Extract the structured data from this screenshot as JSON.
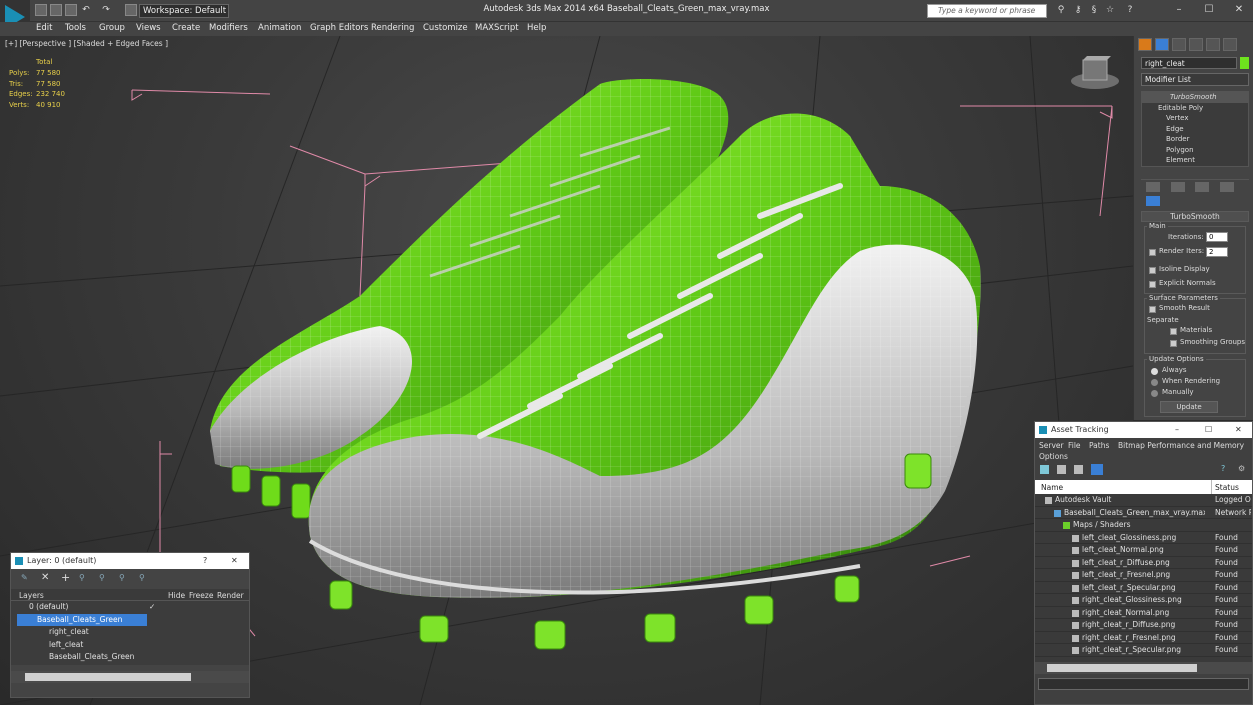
{
  "titlebar": {
    "workspace": "Workspace: Default",
    "title": "Autodesk 3ds Max  2014 x64     Baseball_Cleats_Green_max_vray.max",
    "search_placeholder": "Type a keyword or phrase"
  },
  "menu": [
    "Edit",
    "Tools",
    "Group",
    "Views",
    "Create",
    "Modifiers",
    "Animation",
    "Graph Editors",
    "Rendering",
    "Customize",
    "MAXScript",
    "Help"
  ],
  "viewport": {
    "label": "[+] [Perspective ] [Shaded + Edged Faces ]",
    "stats": {
      "header": "Total",
      "rows": [
        {
          "label": "Polys:",
          "value": "77 580"
        },
        {
          "label": "Tris:",
          "value": "77 580"
        },
        {
          "label": "Edges:",
          "value": "232 740"
        },
        {
          "label": "Verts:",
          "value": "40 910"
        }
      ]
    }
  },
  "command_panel": {
    "object_name": "right_cleat",
    "modifier_list": "Modifier List",
    "stack": [
      "TurboSmooth",
      "Editable Poly",
      "Vertex",
      "Edge",
      "Border",
      "Polygon",
      "Element"
    ],
    "rollout_title": "TurboSmooth",
    "main_label": "Main",
    "iterations_label": "Iterations:",
    "iterations_value": "0",
    "render_iters_label": "Render Iters:",
    "render_iters_value": "2",
    "isoline": "Isoline Display",
    "explicit_normals": "Explicit Normals",
    "surface_params": "Surface Parameters",
    "smooth_result": "Smooth Result",
    "separate": "Separate",
    "materials": "Materials",
    "smoothing_groups": "Smoothing Groups",
    "update_options": "Update Options",
    "always": "Always",
    "when_rendering": "When Rendering",
    "manually": "Manually",
    "update_button": "Update"
  },
  "layers": {
    "title": "Layer: 0 (default)",
    "help": "?",
    "cols": [
      "Layers",
      "Hide",
      "Freeze",
      "Render"
    ],
    "rows": [
      {
        "name": "0 (default)",
        "indent": 0
      },
      {
        "name": "Baseball_Cleats_Green",
        "indent": 0
      },
      {
        "name": "right_cleat",
        "indent": 1
      },
      {
        "name": "left_cleat",
        "indent": 1
      },
      {
        "name": "Baseball_Cleats_Green",
        "indent": 1
      }
    ]
  },
  "asset_tracking": {
    "title": "Asset Tracking",
    "menu": [
      "Server",
      "File",
      "Paths",
      "Bitmap Performance and Memory",
      "Options"
    ],
    "cols": [
      "Name",
      "Status"
    ],
    "rows": [
      {
        "name": "Autodesk Vault",
        "status": "Logged Ou",
        "indent": 0
      },
      {
        "name": "Baseball_Cleats_Green_max_vray.max",
        "status": "Network P",
        "indent": 1
      },
      {
        "name": "Maps / Shaders",
        "status": "",
        "indent": 2
      },
      {
        "name": "left_cleat_Glossiness.png",
        "status": "Found",
        "indent": 3
      },
      {
        "name": "left_cleat_Normal.png",
        "status": "Found",
        "indent": 3
      },
      {
        "name": "left_cleat_r_Diffuse.png",
        "status": "Found",
        "indent": 3
      },
      {
        "name": "left_cleat_r_Fresnel.png",
        "status": "Found",
        "indent": 3
      },
      {
        "name": "left_cleat_r_Specular.png",
        "status": "Found",
        "indent": 3
      },
      {
        "name": "right_cleat_Glossiness.png",
        "status": "Found",
        "indent": 3
      },
      {
        "name": "right_cleat_Normal.png",
        "status": "Found",
        "indent": 3
      },
      {
        "name": "right_cleat_r_Diffuse.png",
        "status": "Found",
        "indent": 3
      },
      {
        "name": "right_cleat_r_Fresnel.png",
        "status": "Found",
        "indent": 3
      },
      {
        "name": "right_cleat_r_Specular.png",
        "status": "Found",
        "indent": 3
      }
    ]
  },
  "colors": {
    "accent": "#7ed321",
    "selection": "#3a7fd5",
    "stat": "#e8d04a"
  }
}
